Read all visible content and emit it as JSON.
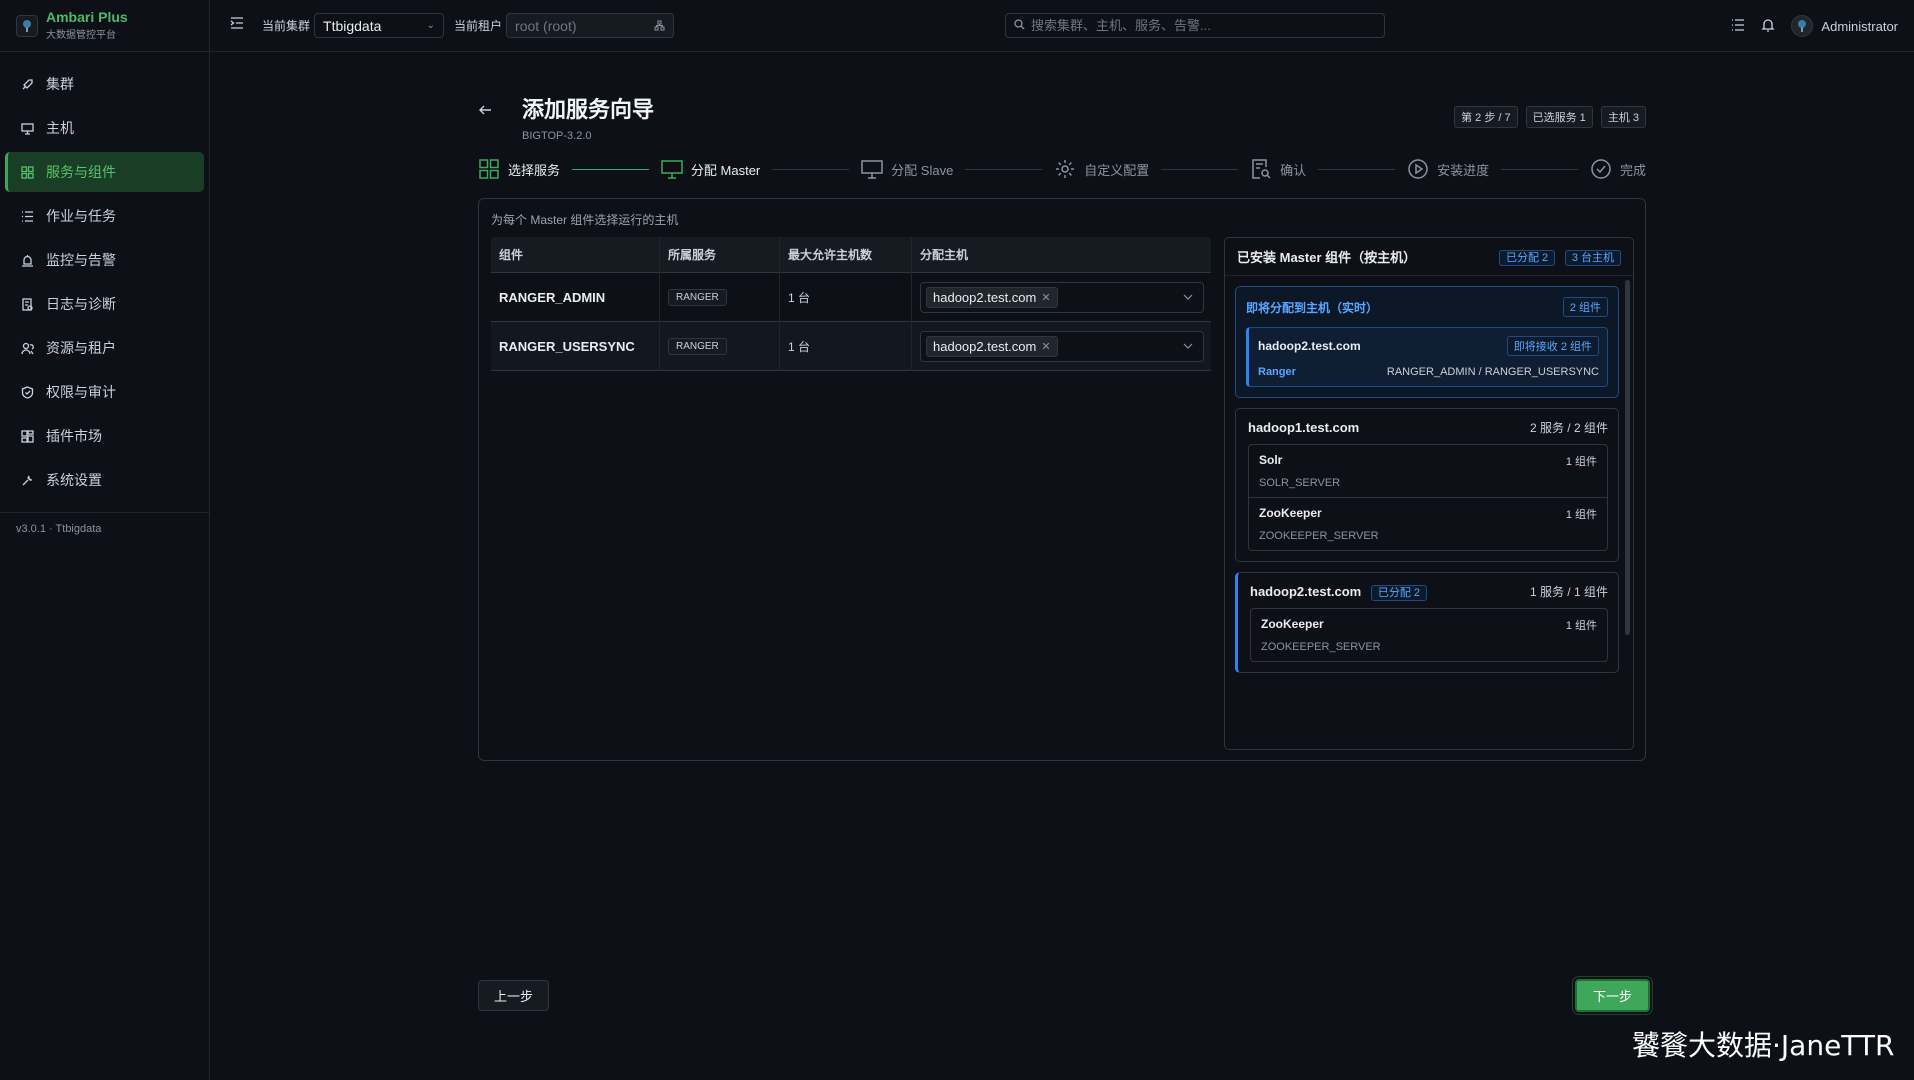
{
  "brand": {
    "name": "Ambari Plus",
    "subtitle": "大数据管控平台"
  },
  "sidebar": {
    "items": [
      {
        "label": "集群",
        "icon": "rocket-icon"
      },
      {
        "label": "主机",
        "icon": "monitor-icon"
      },
      {
        "label": "服务与组件",
        "icon": "grid-icon",
        "active": true
      },
      {
        "label": "作业与任务",
        "icon": "list-icon"
      },
      {
        "label": "监控与告警",
        "icon": "alarm-icon"
      },
      {
        "label": "日志与诊断",
        "icon": "log-icon"
      },
      {
        "label": "资源与租户",
        "icon": "users-icon"
      },
      {
        "label": "权限与审计",
        "icon": "shield-icon"
      },
      {
        "label": "插件市场",
        "icon": "plugin-icon"
      },
      {
        "label": "系统设置",
        "icon": "wrench-icon"
      }
    ],
    "version": "v3.0.1 · Ttbigdata"
  },
  "topbar": {
    "cluster_label": "当前集群",
    "cluster_value": "Ttbigdata",
    "tenant_label": "当前租户",
    "tenant_placeholder": "root (root)",
    "search_placeholder": "搜索集群、主机、服务、告警...",
    "user": "Administrator"
  },
  "wizard": {
    "title": "添加服务向导",
    "subtitle": "BIGTOP-3.2.0",
    "badges": [
      "第 2 步 / 7",
      "已选服务 1",
      "主机 3"
    ],
    "steps": [
      {
        "label": "选择服务",
        "state": "done"
      },
      {
        "label": "分配 Master",
        "state": "current"
      },
      {
        "label": "分配 Slave",
        "state": "todo"
      },
      {
        "label": "自定义配置",
        "state": "todo"
      },
      {
        "label": "确认",
        "state": "todo"
      },
      {
        "label": "安装进度",
        "state": "todo"
      },
      {
        "label": "完成",
        "state": "todo"
      }
    ],
    "hint": "为每个 Master 组件选择运行的主机",
    "table": {
      "headers": [
        "组件",
        "所属服务",
        "最大允许主机数",
        "分配主机"
      ],
      "rows": [
        {
          "component": "RANGER_ADMIN",
          "service": "RANGER",
          "max": "1 台",
          "host": "hadoop2.test.com"
        },
        {
          "component": "RANGER_USERSYNC",
          "service": "RANGER",
          "max": "1 台",
          "host": "hadoop2.test.com"
        }
      ]
    },
    "installed": {
      "title": "已安装 Master 组件（按主机）",
      "tag_assigned": "已分配 2",
      "tag_hosts": "3 台主机",
      "pending": {
        "title": "即将分配到主机（实时）",
        "count": "2 组件",
        "host": "hadoop2.test.com",
        "receive": "即将接收 2 组件",
        "service": "Ranger",
        "components": "RANGER_ADMIN / RANGER_USERSYNC"
      },
      "hosts": [
        {
          "host": "hadoop1.test.com",
          "count": "2 服务 / 2 组件",
          "services": [
            {
              "name": "Solr",
              "count": "1 组件",
              "component": "SOLR_SERVER"
            },
            {
              "name": "ZooKeeper",
              "count": "1 组件",
              "component": "ZOOKEEPER_SERVER"
            }
          ]
        },
        {
          "host": "hadoop2.test.com",
          "tag": "已分配 2",
          "count": "1 服务 / 1 组件",
          "services": [
            {
              "name": "ZooKeeper",
              "count": "1 组件",
              "component": "ZOOKEEPER_SERVER"
            }
          ]
        }
      ]
    },
    "prev_label": "上一步",
    "next_label": "下一步"
  },
  "watermark": "饕餮大数据·JaneTTR",
  "colors": {
    "accent": "#3fa75a",
    "info": "#58a6ff",
    "bg": "#0d1117"
  }
}
